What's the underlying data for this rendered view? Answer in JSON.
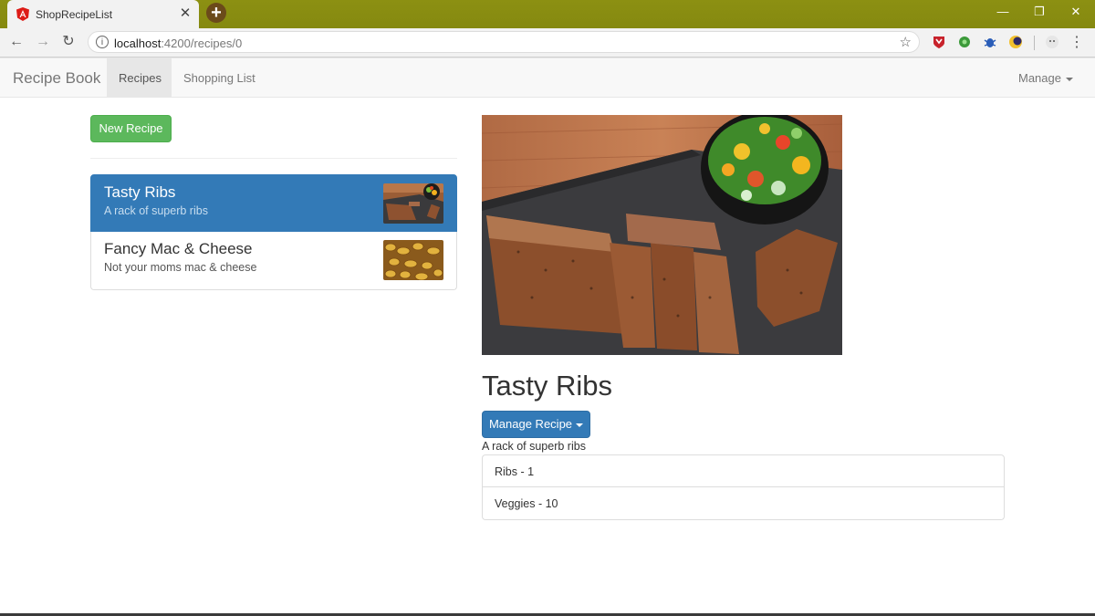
{
  "browser": {
    "tab_title": "ShopRecipeList",
    "url_host": "localhost",
    "url_path": ":4200/recipes/0",
    "tab_close_glyph": "✕",
    "new_tab_glyph": "+",
    "back_glyph": "←",
    "forward_glyph": "→",
    "reload_glyph": "↻",
    "info_glyph": "i",
    "star_glyph": "☆",
    "minimize_glyph": "—",
    "restore_glyph": "❐",
    "close_glyph": "✕",
    "menu_glyph": "⋮",
    "extension_icons": [
      "red-shield-icon",
      "green-gear-icon",
      "blue-bug-icon",
      "yellow-moon-icon",
      "grey-face-icon"
    ]
  },
  "navbar": {
    "brand": "Recipe Book",
    "recipes": "Recipes",
    "shopping_list": "Shopping List",
    "manage": "Manage"
  },
  "recipe_list": {
    "new_recipe_button": "New Recipe",
    "items": [
      {
        "name": "Tasty Ribs",
        "description": "A rack of superb ribs",
        "active": true
      },
      {
        "name": "Fancy Mac & Cheese",
        "description": "Not your moms mac & cheese",
        "active": false
      }
    ]
  },
  "detail": {
    "title": "Tasty Ribs",
    "manage_button": "Manage Recipe",
    "description": "A rack of superb ribs",
    "ingredients": [
      "Ribs - 1",
      "Veggies - 10"
    ]
  },
  "colors": {
    "success": "#5cb85c",
    "primary": "#337ab7",
    "titlebar": "#8a8d12"
  }
}
